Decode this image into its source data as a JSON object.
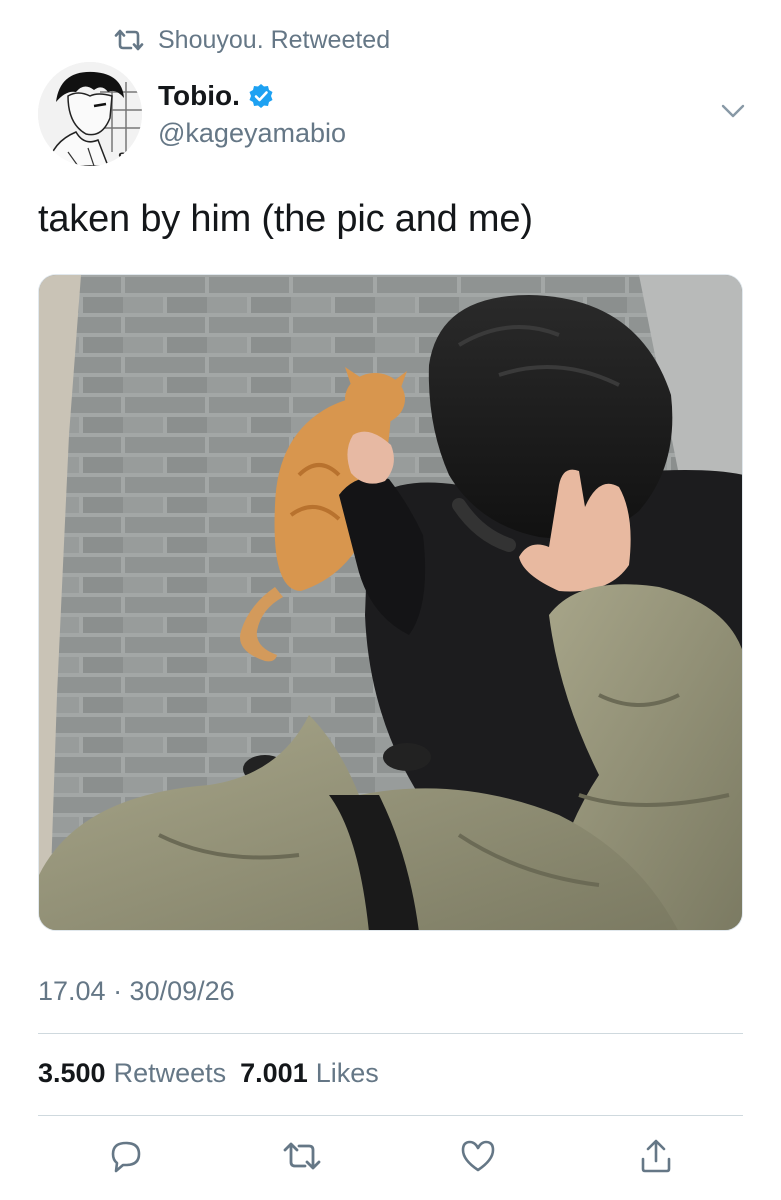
{
  "retweet_context": {
    "icon": "retweet-icon",
    "text": "Shouyou. Retweeted"
  },
  "author": {
    "display_name": "Tobio.",
    "verified": true,
    "handle": "@kageyamabio",
    "avatar": "avatar-manga-illustration"
  },
  "menu": {
    "icon": "chevron-down-icon"
  },
  "tweet": {
    "text": "taken by him (the pic and me)",
    "media": "photo-person-petting-orange-cat-on-sidewalk",
    "timestamp": "17.04 · 30/09/26"
  },
  "stats": {
    "retweets_count": "3.500",
    "retweets_label": "Retweets",
    "likes_count": "7.001",
    "likes_label": "Likes"
  },
  "actions": [
    {
      "name": "reply",
      "icon": "reply-icon"
    },
    {
      "name": "retweet",
      "icon": "retweet-icon"
    },
    {
      "name": "like",
      "icon": "heart-icon"
    },
    {
      "name": "share",
      "icon": "share-icon"
    }
  ],
  "colors": {
    "text_primary": "#14171a",
    "text_secondary": "#657786",
    "verified_blue": "#1da1f2",
    "divider": "#cfd9de"
  }
}
